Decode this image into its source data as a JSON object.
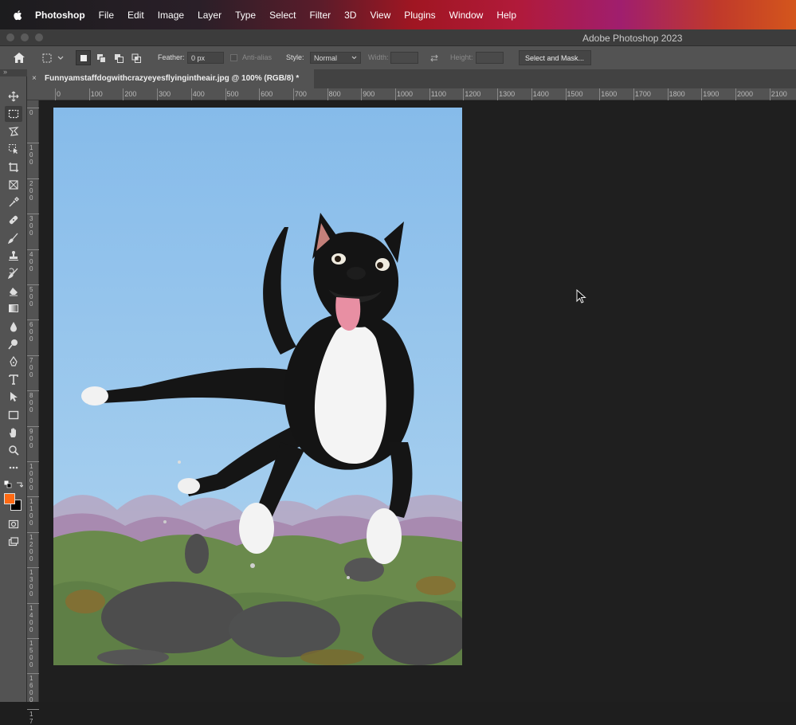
{
  "menubar": {
    "app_name": "Photoshop",
    "items": [
      "File",
      "Edit",
      "Image",
      "Layer",
      "Type",
      "Select",
      "Filter",
      "3D",
      "View",
      "Plugins",
      "Window",
      "Help"
    ]
  },
  "window": {
    "title": "Adobe Photoshop 2023"
  },
  "options": {
    "feather_label": "Feather:",
    "feather_value": "0 px",
    "antialias_label": "Anti-alias",
    "style_label": "Style:",
    "style_value": "Normal",
    "width_label": "Width:",
    "height_label": "Height:",
    "select_mask_label": "Select and Mask..."
  },
  "document": {
    "close_glyph": "×",
    "tab_title": "Funnyamstaffdogwithcrazyeyesflyingintheair.jpg @ 100% (RGB/8) *"
  },
  "panel_toggle": "»",
  "ruler": {
    "top_labels": [
      "0",
      "100",
      "200",
      "300",
      "400",
      "500",
      "600",
      "700",
      "800",
      "900",
      "1000",
      "1100",
      "1200",
      "1300",
      "1400",
      "1500",
      "1600",
      "1700",
      "1800",
      "1900",
      "2000",
      "2100"
    ],
    "left_labels": [
      "0",
      "1 0 0",
      "2 0 0",
      "3 0 0",
      "4 0 0",
      "5 0 0",
      "6 0 0",
      "7 0 0",
      "8 0 0",
      "9 0 0",
      "1 0 0 0",
      "1 1 0 0",
      "1 2 0 0",
      "1 3 0 0",
      "1 4 0 0",
      "1 5 0 0",
      "1 6 0 0",
      "1 7"
    ]
  },
  "colors": {
    "foreground": "#ff6a13",
    "background": "#000000",
    "sky": "#8ec2ee",
    "grass": "#6a8a4c"
  },
  "tools": [
    "move-icon",
    "rectangular-marquee-icon",
    "lasso-icon",
    "object-selection-icon",
    "crop-icon",
    "frame-icon",
    "eyedropper-icon",
    "healing-brush-icon",
    "brush-icon",
    "clone-stamp-icon",
    "history-brush-icon",
    "eraser-icon",
    "gradient-icon",
    "blur-icon",
    "dodge-icon",
    "pen-icon",
    "type-icon",
    "path-selection-icon",
    "rectangle-icon",
    "hand-icon",
    "zoom-icon",
    "more-tools-icon"
  ]
}
